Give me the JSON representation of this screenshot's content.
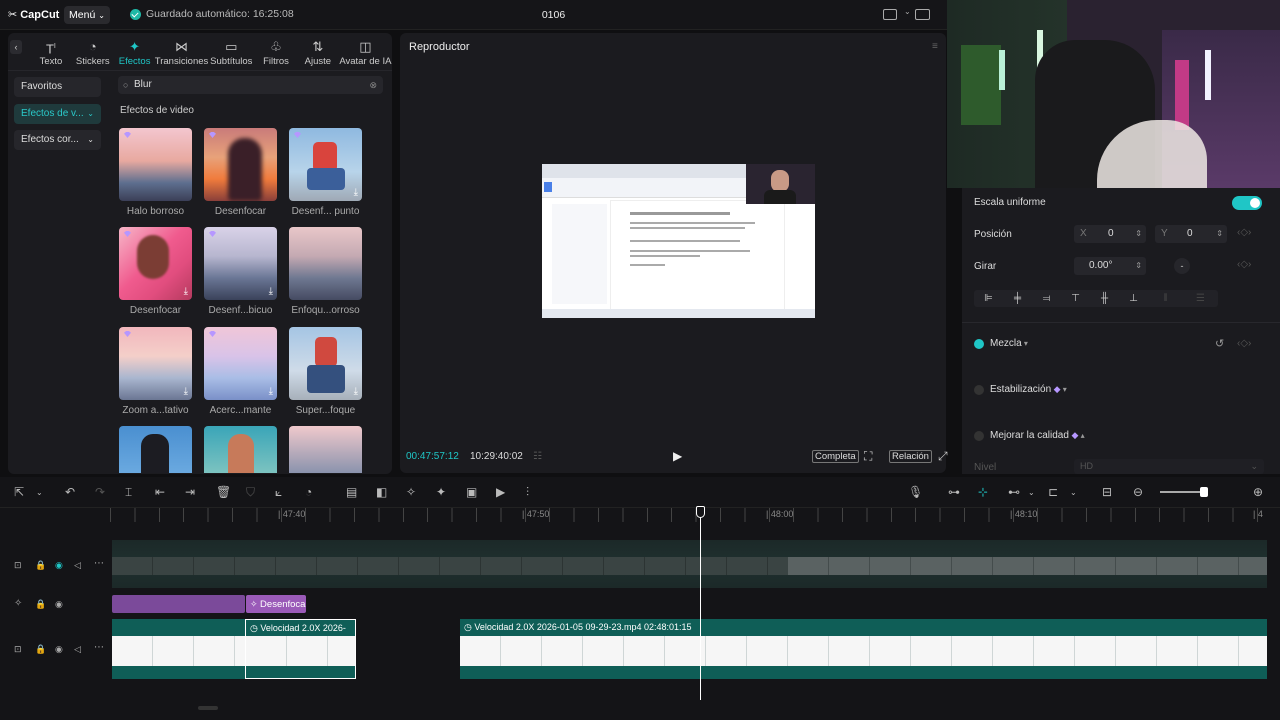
{
  "app": {
    "logo": "CapCut",
    "menu_label": "Menú",
    "autosave": "Guardado automático: 16:25:08",
    "project_title": "0106"
  },
  "tabs": [
    {
      "label": "Texto",
      "icon": "text-icon"
    },
    {
      "label": "Stickers",
      "icon": "sticker-icon"
    },
    {
      "label": "Efectos",
      "icon": "effects-icon",
      "active": true
    },
    {
      "label": "Transiciones",
      "icon": "transition-icon"
    },
    {
      "label": "Subtítulos",
      "icon": "subtitle-icon"
    },
    {
      "label": "Filtros",
      "icon": "filter-icon"
    },
    {
      "label": "Ajuste",
      "icon": "adjust-icon"
    },
    {
      "label": "Avatar de IA",
      "icon": "avatar-icon"
    }
  ],
  "categories": [
    {
      "label": "Favoritos"
    },
    {
      "label": "Efectos de v..."
    },
    {
      "label": "Efectos cor..."
    }
  ],
  "search": {
    "value": "Blur"
  },
  "effects_section_title": "Efectos de video",
  "effects": [
    {
      "label": "Halo borroso"
    },
    {
      "label": "Desenfocar"
    },
    {
      "label": "Desenf... punto"
    },
    {
      "label": "Desenfocar"
    },
    {
      "label": "Desenf...bicuo"
    },
    {
      "label": "Enfoqu...orroso"
    },
    {
      "label": "Zoom a...tativo"
    },
    {
      "label": "Acerc...mante"
    },
    {
      "label": "Super...foque"
    }
  ],
  "player": {
    "title": "Reproductor",
    "current_time": "00:47:57:12",
    "total_time": "10:29:40:02",
    "full_label": "Completa",
    "ratio_label": "Relación"
  },
  "properties": {
    "uniform_scale": "Escala uniforme",
    "position": "Posición",
    "x_label": "X",
    "x_value": "0",
    "y_label": "Y",
    "y_value": "0",
    "rotate": "Girar",
    "rotate_value": "0.00°",
    "blend": "Mezcla",
    "stabilization": "Estabilización",
    "enhance": "Mejorar la calidad",
    "level": "Nivel",
    "level_value": "HD"
  },
  "ruler": [
    "47:40",
    "47:50",
    "48:00",
    "48:10"
  ],
  "clips": {
    "effect_clip": "Desenfoca",
    "clip1": "Velocidad 2.0X  2026-",
    "clip2": "Velocidad 2.0X  2026-01-05 09-29-23.mp4  02:48:01:15"
  }
}
